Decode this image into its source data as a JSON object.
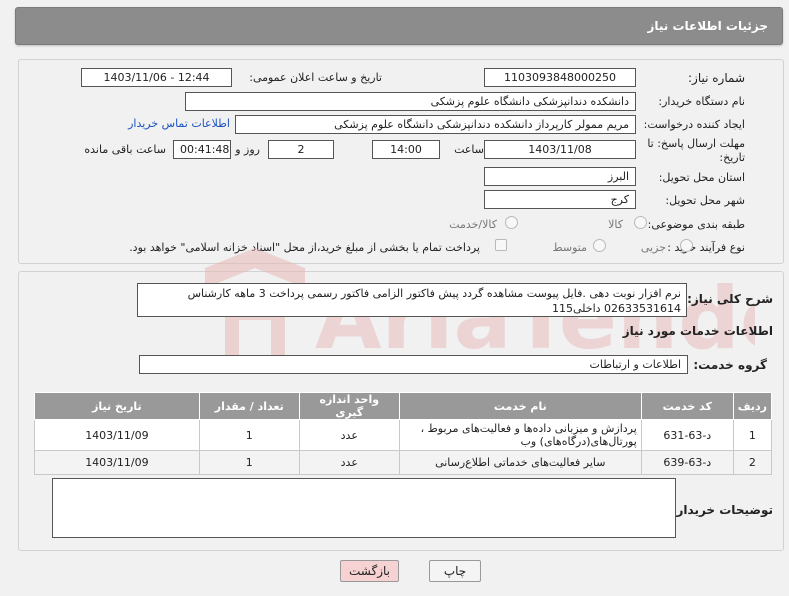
{
  "header": {
    "title": "جزئیات اطلاعات نیاز"
  },
  "form": {
    "need_number_label": "شماره نیاز:",
    "need_number": "1103093848000250",
    "announce_label": "تاریخ و ساعت اعلان عمومی:",
    "announce_value": "1403/11/06 - 12:44",
    "buyer_org_label": "نام دستگاه خریدار:",
    "buyer_org": "دانشکده دندانپزشکی دانشگاه علوم پزشکی",
    "creator_label": "ایجاد کننده درخواست:",
    "creator": "مریم ممولر کارپرداز دانشکده دندانپزشکی دانشگاه علوم پزشکی",
    "contact_link": "اطلاعات تماس خریدار",
    "deadline_label": "مهلت ارسال پاسخ: تا تاریخ:",
    "deadline_date": "1403/11/08",
    "time_label": "ساعت",
    "deadline_time": "14:00",
    "days_value": "2",
    "days_label": "روز و",
    "remaining_time": "00:41:48",
    "remaining_label": "ساعت باقی مانده",
    "province_label": "استان محل تحویل:",
    "province": "البرز",
    "city_label": "شهر محل تحویل:",
    "city": "کرج",
    "category_label": "طبقه بندی موضوعی:",
    "category_options": [
      "کالا",
      "کالا/خدمت"
    ],
    "process_label": "نوع فرآیند خرید :",
    "process_options": [
      "جزیی",
      "متوسط"
    ],
    "payment_note": "پرداخت تمام یا بخشی از مبلغ خرید،از محل \"اسناد خزانه اسلامی\" خواهد بود."
  },
  "description": {
    "label": "شرح کلی نیاز:",
    "text": "نرم افزار نوبت دهی .فایل پیوست مشاهده گردد پیش فاکتور الزامی فاکتور رسمی پرداخت 3 ماهه کارشناس 02633531614 داخلی115"
  },
  "services": {
    "section_title": "اطلاعات خدمات مورد نیاز",
    "group_label": "گروه خدمت:",
    "group_value": "اطلاعات و ارتباطات",
    "columns": [
      "ردیف",
      "کد خدمت",
      "نام خدمت",
      "واحد اندازه گیری",
      "تعداد / مقدار",
      "تاریخ نیاز"
    ],
    "rows": [
      {
        "row": "1",
        "code": "د-63-631",
        "name": "پردازش و میزبانی داده‌ها و فعالیت‌های مربوط ، پورتال‌های(درگاه‌های) وب",
        "unit": "عدد",
        "qty": "1",
        "date": "1403/11/09"
      },
      {
        "row": "2",
        "code": "د-63-639",
        "name": "سایر فعالیت‌های خدماتی اطلاع‌رسانی",
        "unit": "عدد",
        "qty": "1",
        "date": "1403/11/09"
      }
    ]
  },
  "buyer_notes": {
    "label": "توضیحات خریدار:",
    "value": ""
  },
  "buttons": {
    "print": "چاپ",
    "back": "بازگشت"
  },
  "watermark": {
    "text": "AriaTender.neT"
  },
  "colors": {
    "header_bg": "#8c8c8c",
    "link": "#1a53c4",
    "back_button_bg": "#f6d2d2",
    "watermark": "#e8b8b8"
  }
}
